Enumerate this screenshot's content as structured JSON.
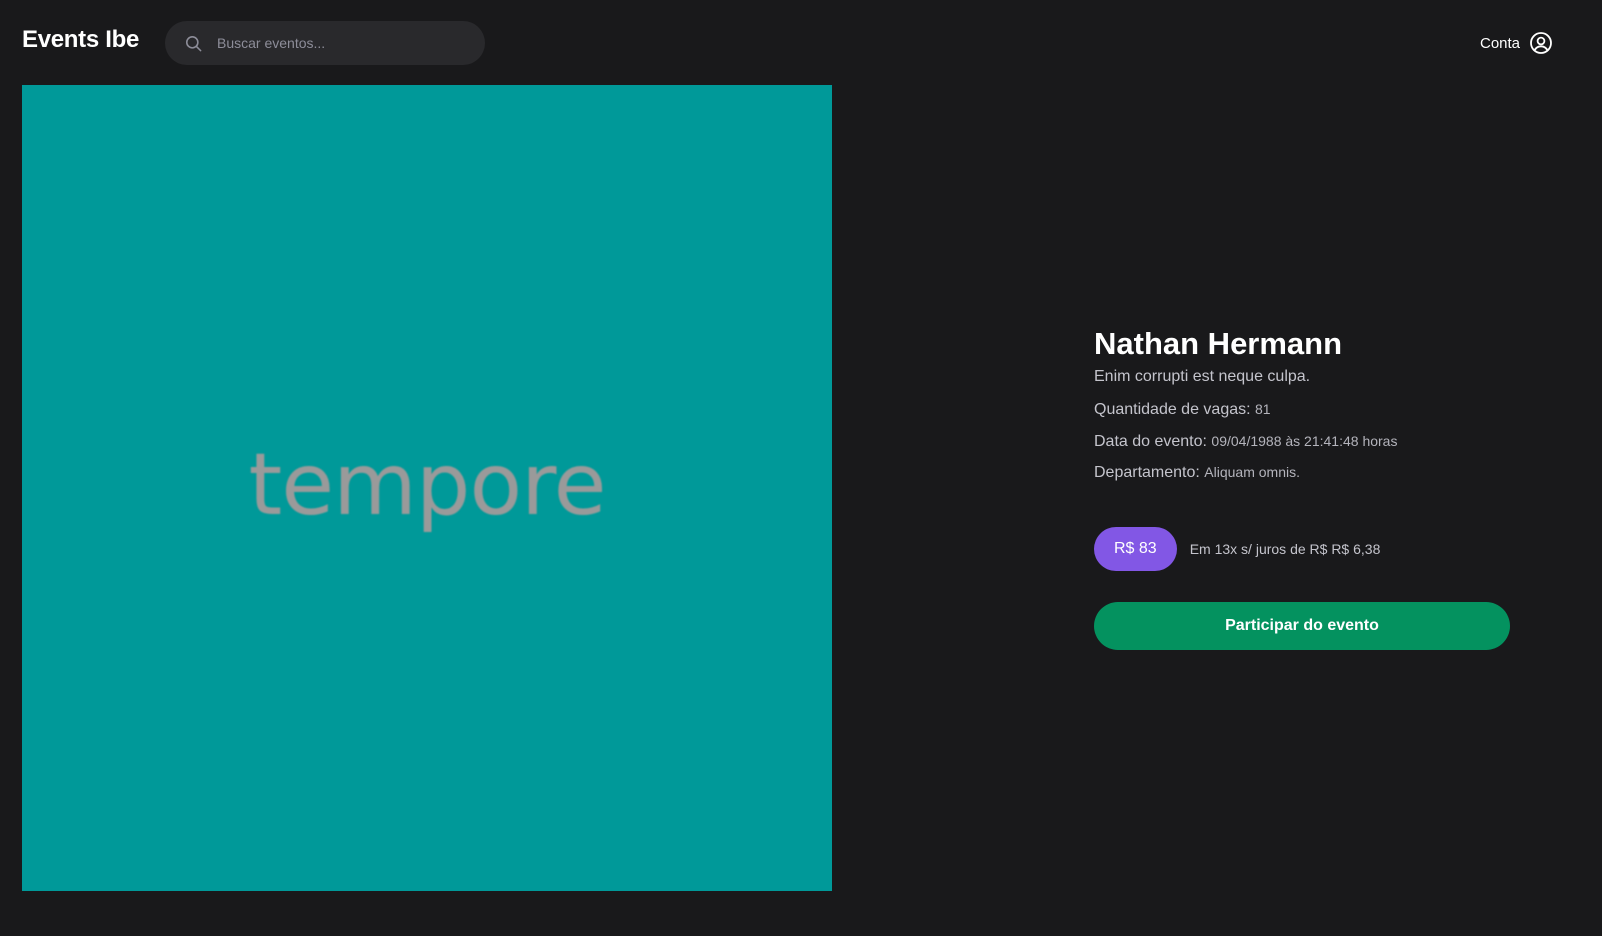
{
  "header": {
    "logo": "Events Ibe",
    "search": {
      "placeholder": "Buscar eventos...",
      "value": ""
    },
    "account_label": "Conta"
  },
  "event": {
    "image_text": "tempore",
    "image_color": "#009999",
    "title": "Nathan Hermann",
    "description": "Enim corrupti est neque culpa.",
    "vacancies_label": "Quantidade de vagas:",
    "vacancies_value": "81",
    "date_label": "Data do evento:",
    "date_value": "09/04/1988 às 21:41:48 horas",
    "department_label": "Departamento:",
    "department_value": "Aliquam omnis.",
    "price": "R$ 83",
    "installments": "Em 13x s/ juros de R$ R$ 6,38",
    "join_button": "Participar do evento"
  },
  "colors": {
    "background": "#19191b",
    "price_badge": "#8257e5",
    "join_button": "#04925f"
  },
  "icons": {
    "search": "search-icon",
    "account": "user-circle-icon"
  }
}
